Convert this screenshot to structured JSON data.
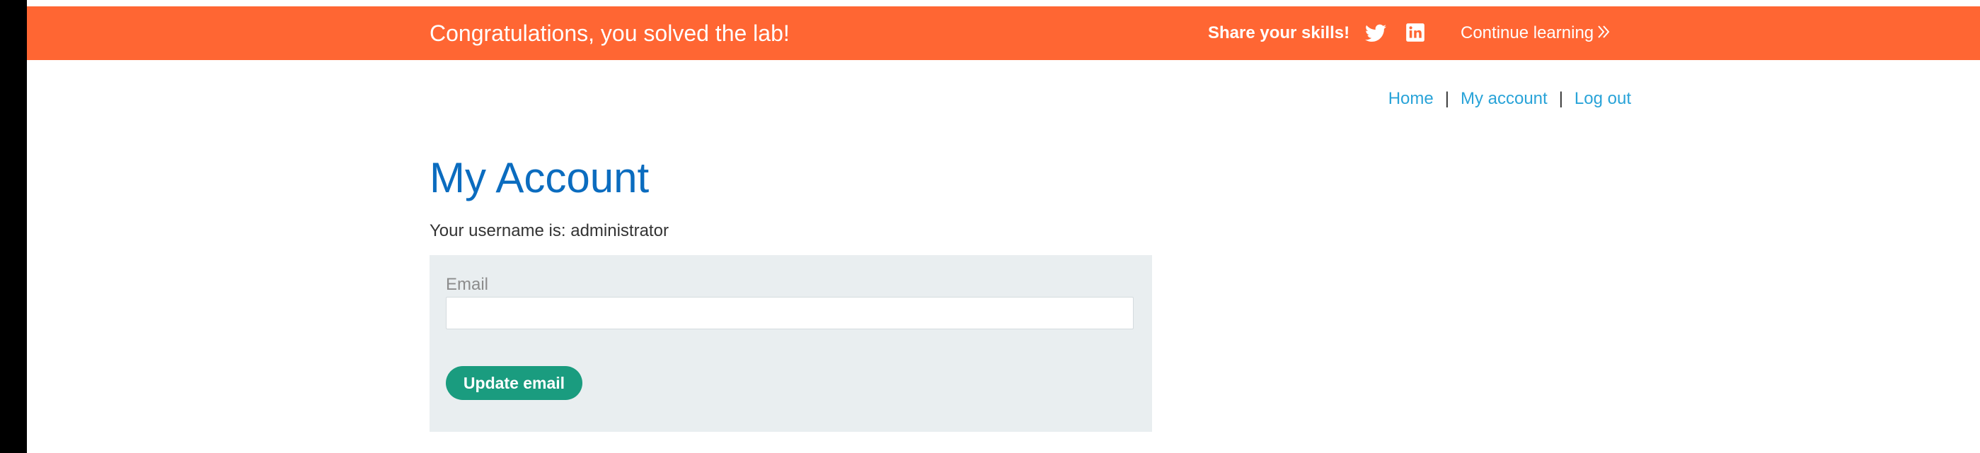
{
  "banner": {
    "title": "Congratulations, you solved the lab!",
    "share_label": "Share your skills!",
    "twitter_icon": "twitter-icon",
    "linkedin_icon": "linkedin-icon",
    "continue_label": "Continue learning",
    "continue_icon": "double-chevron-right-icon",
    "background_color": "#ff6633"
  },
  "nav": {
    "items": [
      {
        "label": "Home"
      },
      {
        "label": "My account"
      },
      {
        "label": "Log out"
      }
    ],
    "separator": "|",
    "link_color": "#29a3d8"
  },
  "main": {
    "title": "My Account",
    "username_text": "Your username is: administrator",
    "title_color": "#0b6cbf"
  },
  "form": {
    "email_label": "Email",
    "email_value": "",
    "email_placeholder": "",
    "submit_label": "Update email",
    "button_color": "#1a9c7f",
    "panel_color": "#e9eef0"
  }
}
